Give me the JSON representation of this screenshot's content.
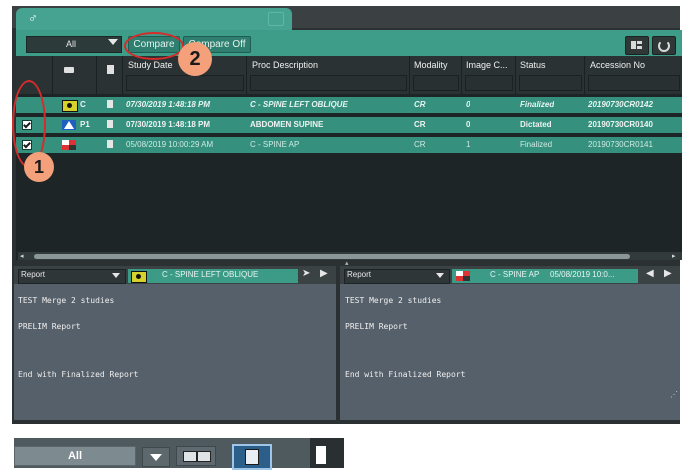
{
  "app": {
    "tab_icon": "male-symbol-icon"
  },
  "toolbar": {
    "filter_value": "All",
    "compare_label": "Compare",
    "compare_off_label": "Compare Off"
  },
  "grid": {
    "columns": [
      "Study Date",
      "Proc Description",
      "Modality",
      "Image C...",
      "Status",
      "Accession No"
    ],
    "rows": [
      {
        "label": "C",
        "date": "07/30/2019 1:48:18 PM",
        "desc": "C - SPINE LEFT OBLIQUE",
        "modality": "CR",
        "images": "0",
        "status": "Finalized",
        "accession": "20190730CR0142"
      },
      {
        "label": "P1",
        "date": "07/30/2019 1:48:18 PM",
        "desc": "ABDOMEN SUPINE",
        "modality": "CR",
        "images": "0",
        "status": "Dictated",
        "accession": "20190730CR0140"
      },
      {
        "label": "",
        "date": "05/08/2019 10:00:29 AM",
        "desc": "C - SPINE AP",
        "modality": "CR",
        "images": "1",
        "status": "Finalized",
        "accession": "20190730CR0141"
      }
    ]
  },
  "left_report": {
    "type": "Report",
    "study": "C - SPINE LEFT OBLIQUE",
    "lines": [
      "TEST Merge 2 studies",
      "PRELIM Report",
      "End with Finalized Report"
    ]
  },
  "right_report": {
    "type": "Report",
    "study": "C - SPINE AP",
    "date": "05/08/2019 10:0...",
    "lines": [
      "TEST Merge 2 studies",
      "PRELIM Report",
      "End with Finalized Report"
    ]
  },
  "annotations": {
    "one": "1",
    "two": "2"
  },
  "bottom": {
    "filter_value": "All"
  },
  "colors": {
    "accent": "#3e9d89",
    "selected_row": "#2f8f7e",
    "annotation": "#f4a07a",
    "ring": "#d62b2b"
  }
}
